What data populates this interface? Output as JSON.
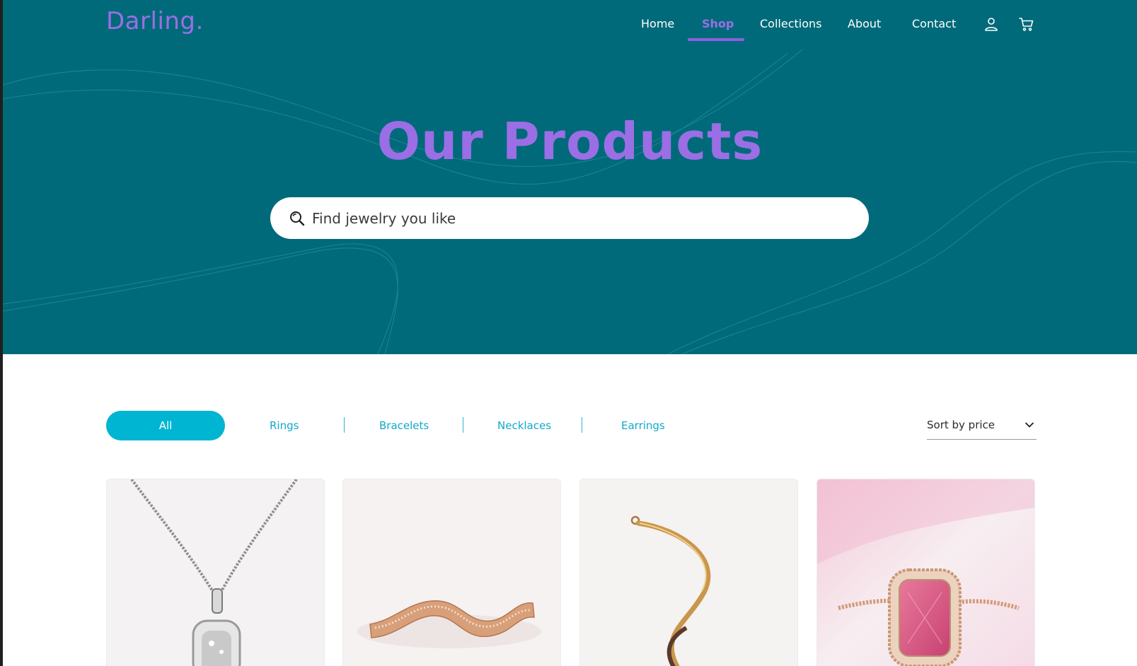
{
  "brand": {
    "logo": "Darling."
  },
  "nav": {
    "items": [
      {
        "label": "Home"
      },
      {
        "label": "Shop",
        "active": true
      },
      {
        "label": "Collections"
      },
      {
        "label": "About"
      },
      {
        "label": "Contact"
      }
    ],
    "icons": [
      "user-icon",
      "cart-icon"
    ]
  },
  "hero": {
    "title": "Our Products",
    "search": {
      "placeholder": "Find jewelry you like",
      "value": ""
    }
  },
  "filters": {
    "items": [
      {
        "label": "All",
        "active": true
      },
      {
        "label": "Rings"
      },
      {
        "label": "Bracelets"
      },
      {
        "label": "Necklaces"
      },
      {
        "label": "Earrings"
      }
    ],
    "sort": {
      "label": "Sort by price"
    }
  },
  "products": [
    {
      "image": "silver-pendant-necklace"
    },
    {
      "image": "rose-gold-wave-band-ring"
    },
    {
      "image": "gold-snake-chain-bracelet"
    },
    {
      "image": "pink-gemstone-halo-ring"
    }
  ],
  "colors": {
    "hero_bg": "#006a7a",
    "accent_purple": "#9b6ee6",
    "accent_cyan": "#00b5d1",
    "page_bg": "#ffffff"
  }
}
